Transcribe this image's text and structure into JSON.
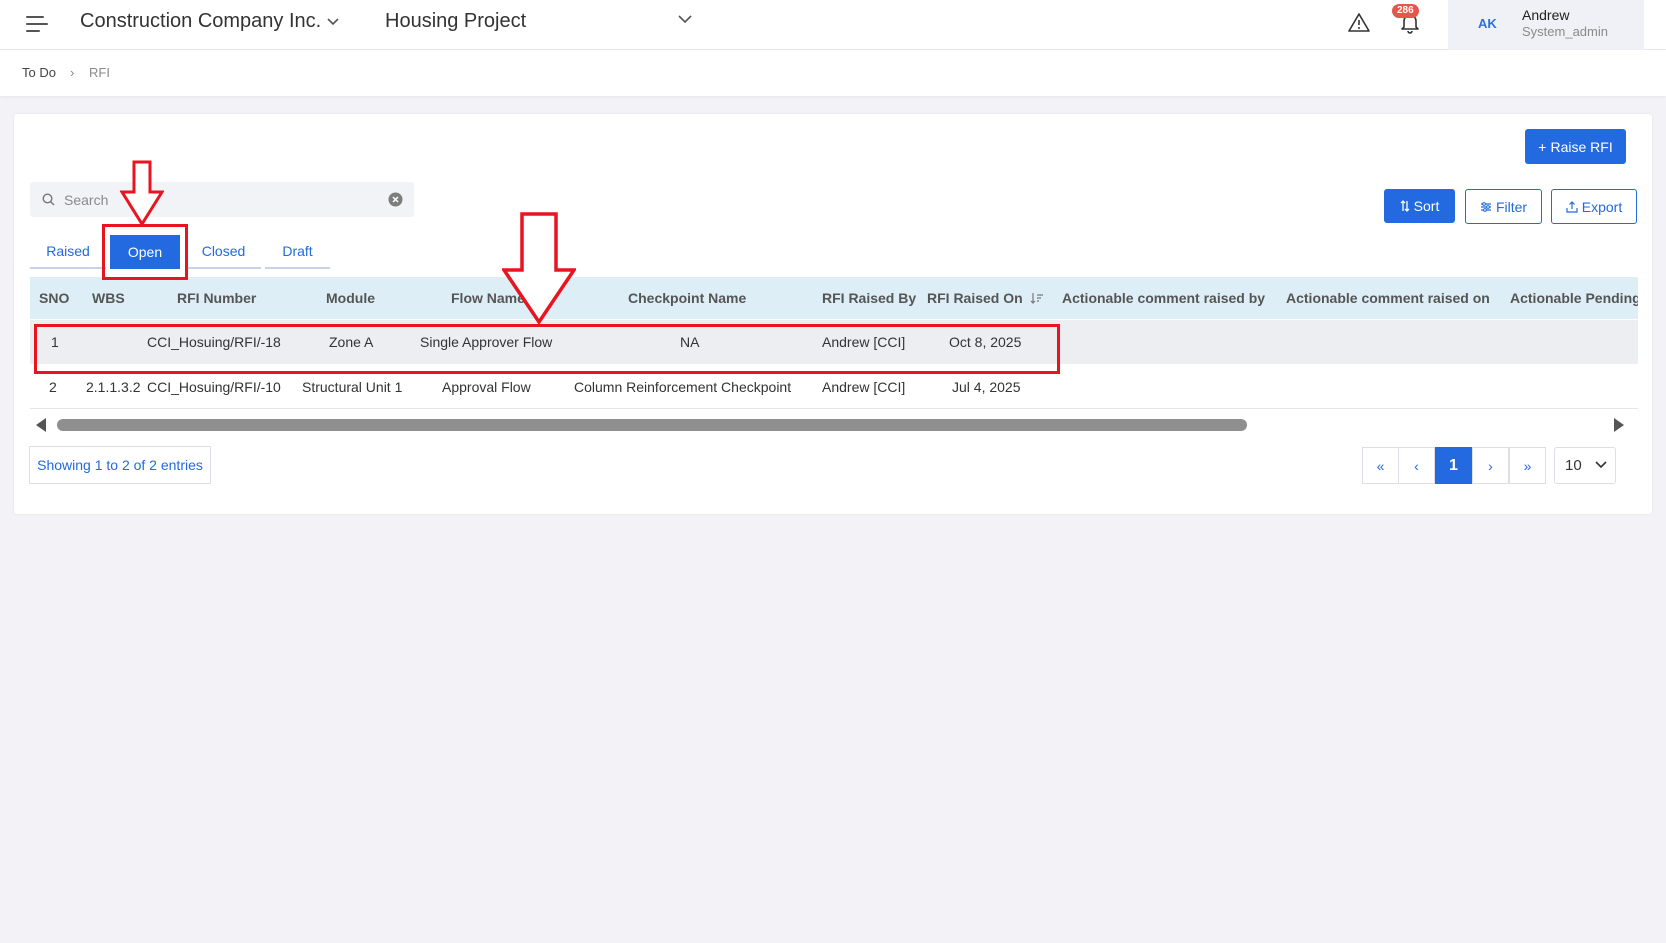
{
  "header": {
    "company": "Construction Company Inc.",
    "project": "Housing Project",
    "notifications_count": "286",
    "user": {
      "initials": "AK",
      "name": "Andrew",
      "role": "System_admin"
    }
  },
  "breadcrumb": {
    "items": [
      "To Do",
      "RFI"
    ],
    "separator": "›"
  },
  "actions": {
    "raise_rfi": "Raise RFI",
    "sort": "Sort",
    "filter": "Filter",
    "export": "Export"
  },
  "search": {
    "placeholder": "Search",
    "value": ""
  },
  "tabs": [
    {
      "label": "Raised",
      "active": false
    },
    {
      "label": "Open",
      "active": true
    },
    {
      "label": "Closed",
      "active": false
    },
    {
      "label": "Draft",
      "active": false
    }
  ],
  "table": {
    "columns": [
      "SNO",
      "WBS",
      "RFI Number",
      "Module",
      "Flow Name",
      "Checkpoint Name",
      "RFI Raised By",
      "RFI Raised On",
      "Actionable comment raised by",
      "Actionable comment raised on",
      "Actionable Pending"
    ],
    "sorted_column": "RFI Raised On",
    "rows": [
      {
        "sno": "1",
        "wbs": "",
        "rfi_number": "CCI_Hosuing/RFI/-18",
        "module": "Zone A",
        "flow_name": "Single Approver Flow",
        "checkpoint": "NA",
        "raised_by": "Andrew [CCI]",
        "raised_on": "Oct 8, 2025"
      },
      {
        "sno": "2",
        "wbs": "2.1.1.3.2",
        "rfi_number": "CCI_Hosuing/RFI/-10",
        "module": "Structural Unit 1",
        "flow_name": "Approval Flow",
        "checkpoint": "Column Reinforcement Checkpoint",
        "raised_by": "Andrew [CCI]",
        "raised_on": "Jul 4, 2025"
      }
    ]
  },
  "footer": {
    "showing": "Showing 1 to 2 of 2 entries",
    "pagination": {
      "first": "«",
      "prev": "‹",
      "current": "1",
      "next": "›",
      "last": "»"
    },
    "page_size": "10"
  },
  "colors": {
    "primary": "#2369e0",
    "annotation": "#e8141f",
    "header_row": "#ddeef6",
    "badge": "#e8564b"
  }
}
